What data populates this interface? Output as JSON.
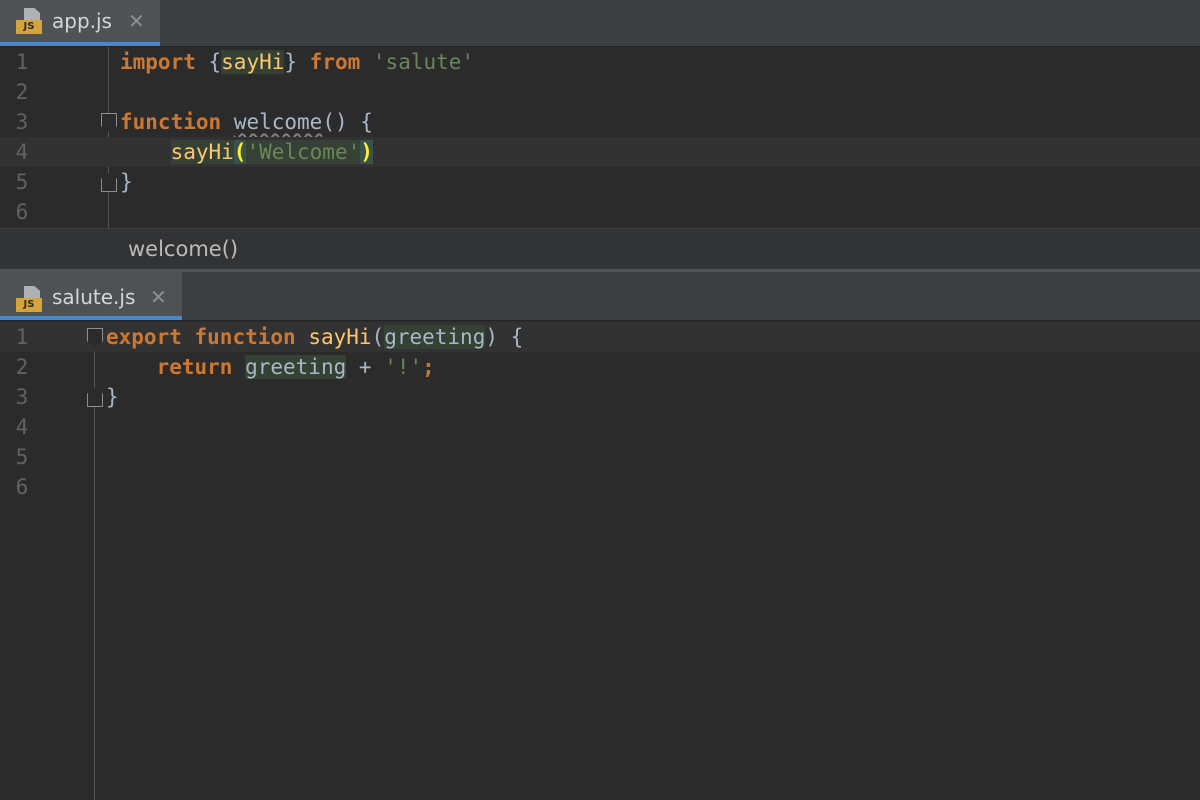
{
  "top_editor": {
    "tab": {
      "label": "app.js",
      "icon": "js-file-icon",
      "close": "✕"
    },
    "lines": [
      {
        "num": "1",
        "tokens": [
          {
            "t": "import",
            "c": "kw"
          },
          {
            "t": " {",
            "c": "id"
          },
          {
            "t": "sayHi",
            "c": "fn hl"
          },
          {
            "t": "} ",
            "c": "id"
          },
          {
            "t": "from",
            "c": "kw"
          },
          {
            "t": " ",
            "c": "id"
          },
          {
            "t": "'salute'",
            "c": "str"
          }
        ]
      },
      {
        "num": "2",
        "tokens": []
      },
      {
        "num": "3",
        "tokens": [
          {
            "t": "function",
            "c": "kw"
          },
          {
            "t": " ",
            "c": "id"
          },
          {
            "t": "welcome",
            "c": "id squiggle"
          },
          {
            "t": "() {",
            "c": "id"
          }
        ]
      },
      {
        "num": "4",
        "current": true,
        "tokens": [
          {
            "t": "    ",
            "c": "id"
          },
          {
            "t": "sayHi",
            "c": "fn hl"
          },
          {
            "t": "(",
            "c": "paren-match"
          },
          {
            "t": "'Welcome'",
            "c": "str hl"
          },
          {
            "t": ")",
            "c": "paren-match"
          }
        ]
      },
      {
        "num": "5",
        "tokens": [
          {
            "t": "}",
            "c": "id"
          }
        ]
      },
      {
        "num": "6",
        "tokens": []
      }
    ],
    "breadcrumb": "welcome()"
  },
  "bottom_editor": {
    "tab": {
      "label": "salute.js",
      "icon": "js-file-icon",
      "close": "✕"
    },
    "lines": [
      {
        "num": "1",
        "current": true,
        "tokens": [
          {
            "t": "export",
            "c": "kw"
          },
          {
            "t": " ",
            "c": "id"
          },
          {
            "t": "function",
            "c": "kw"
          },
          {
            "t": " ",
            "c": "id"
          },
          {
            "t": "sayHi",
            "c": "fn"
          },
          {
            "t": "(",
            "c": "id"
          },
          {
            "t": "greeting",
            "c": "id hl"
          },
          {
            "t": ") {",
            "c": "id"
          }
        ]
      },
      {
        "num": "2",
        "tokens": [
          {
            "t": "    ",
            "c": "id"
          },
          {
            "t": "return",
            "c": "kw"
          },
          {
            "t": " ",
            "c": "id"
          },
          {
            "t": "greeting",
            "c": "id hl"
          },
          {
            "t": " + ",
            "c": "id"
          },
          {
            "t": "'!'",
            "c": "str"
          },
          {
            "t": ";",
            "c": "kw"
          }
        ]
      },
      {
        "num": "3",
        "tokens": [
          {
            "t": "}",
            "c": "id"
          }
        ]
      },
      {
        "num": "4",
        "tokens": []
      },
      {
        "num": "5",
        "tokens": []
      },
      {
        "num": "6",
        "tokens": []
      }
    ]
  },
  "colors": {
    "keyword": "#cc7832",
    "string": "#6a8759",
    "function": "#ffc66d",
    "identifier": "#a9b7c6",
    "tab_underline": "#4a88c7",
    "js_badge": "#d5a53b"
  }
}
